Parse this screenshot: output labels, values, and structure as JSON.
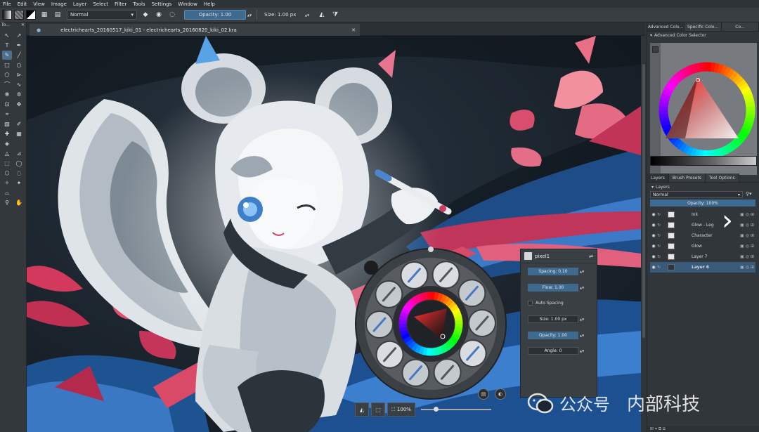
{
  "menu": [
    "File",
    "Edit",
    "View",
    "Image",
    "Layer",
    "Select",
    "Filter",
    "Tools",
    "Settings",
    "Window",
    "Help"
  ],
  "toolbar": {
    "blend_mode": "Normal",
    "opacity": "Opacity:  1.00",
    "size": "Size:  1.00 px"
  },
  "toolbox_title": "To...",
  "document": {
    "tab_title": "electrichearts_20160517_kiki_01 - electrichearts_20160820_kiki_02.kra"
  },
  "status": {
    "zoom": "100%"
  },
  "docker": {
    "tabs": [
      "Advanced Colo...",
      "Specific Colo...",
      "Co..."
    ],
    "color_selector_title": "Advanced Color Selector",
    "layer_tabs": [
      "Layers",
      "Brush Presets",
      "Tool Options"
    ],
    "layers_title": "Layers",
    "blend_mode": "Normal",
    "opacity": "Opacity:  100%",
    "layers": [
      {
        "name": "Ink"
      },
      {
        "name": "Glow - Leg"
      },
      {
        "name": "Character"
      },
      {
        "name": "Glow"
      },
      {
        "name": "Layer 7"
      },
      {
        "name": "Layer 6"
      }
    ]
  },
  "brush_popup": {
    "preset": "pixel1",
    "spacing": "Spacing:  0.10",
    "flow": "Flow:  1.00",
    "auto_spacing": "Auto Spacing",
    "size": "Size:  1.00 px",
    "opacity": "Opacity:  1.00",
    "angle": "Angle:  0"
  },
  "watermark": {
    "account": "公众号",
    "name": "内部科技"
  },
  "colors": {
    "accent": "#3f6a8f",
    "canvas_bg": "#18212a",
    "panel_bg": "#31363b"
  }
}
